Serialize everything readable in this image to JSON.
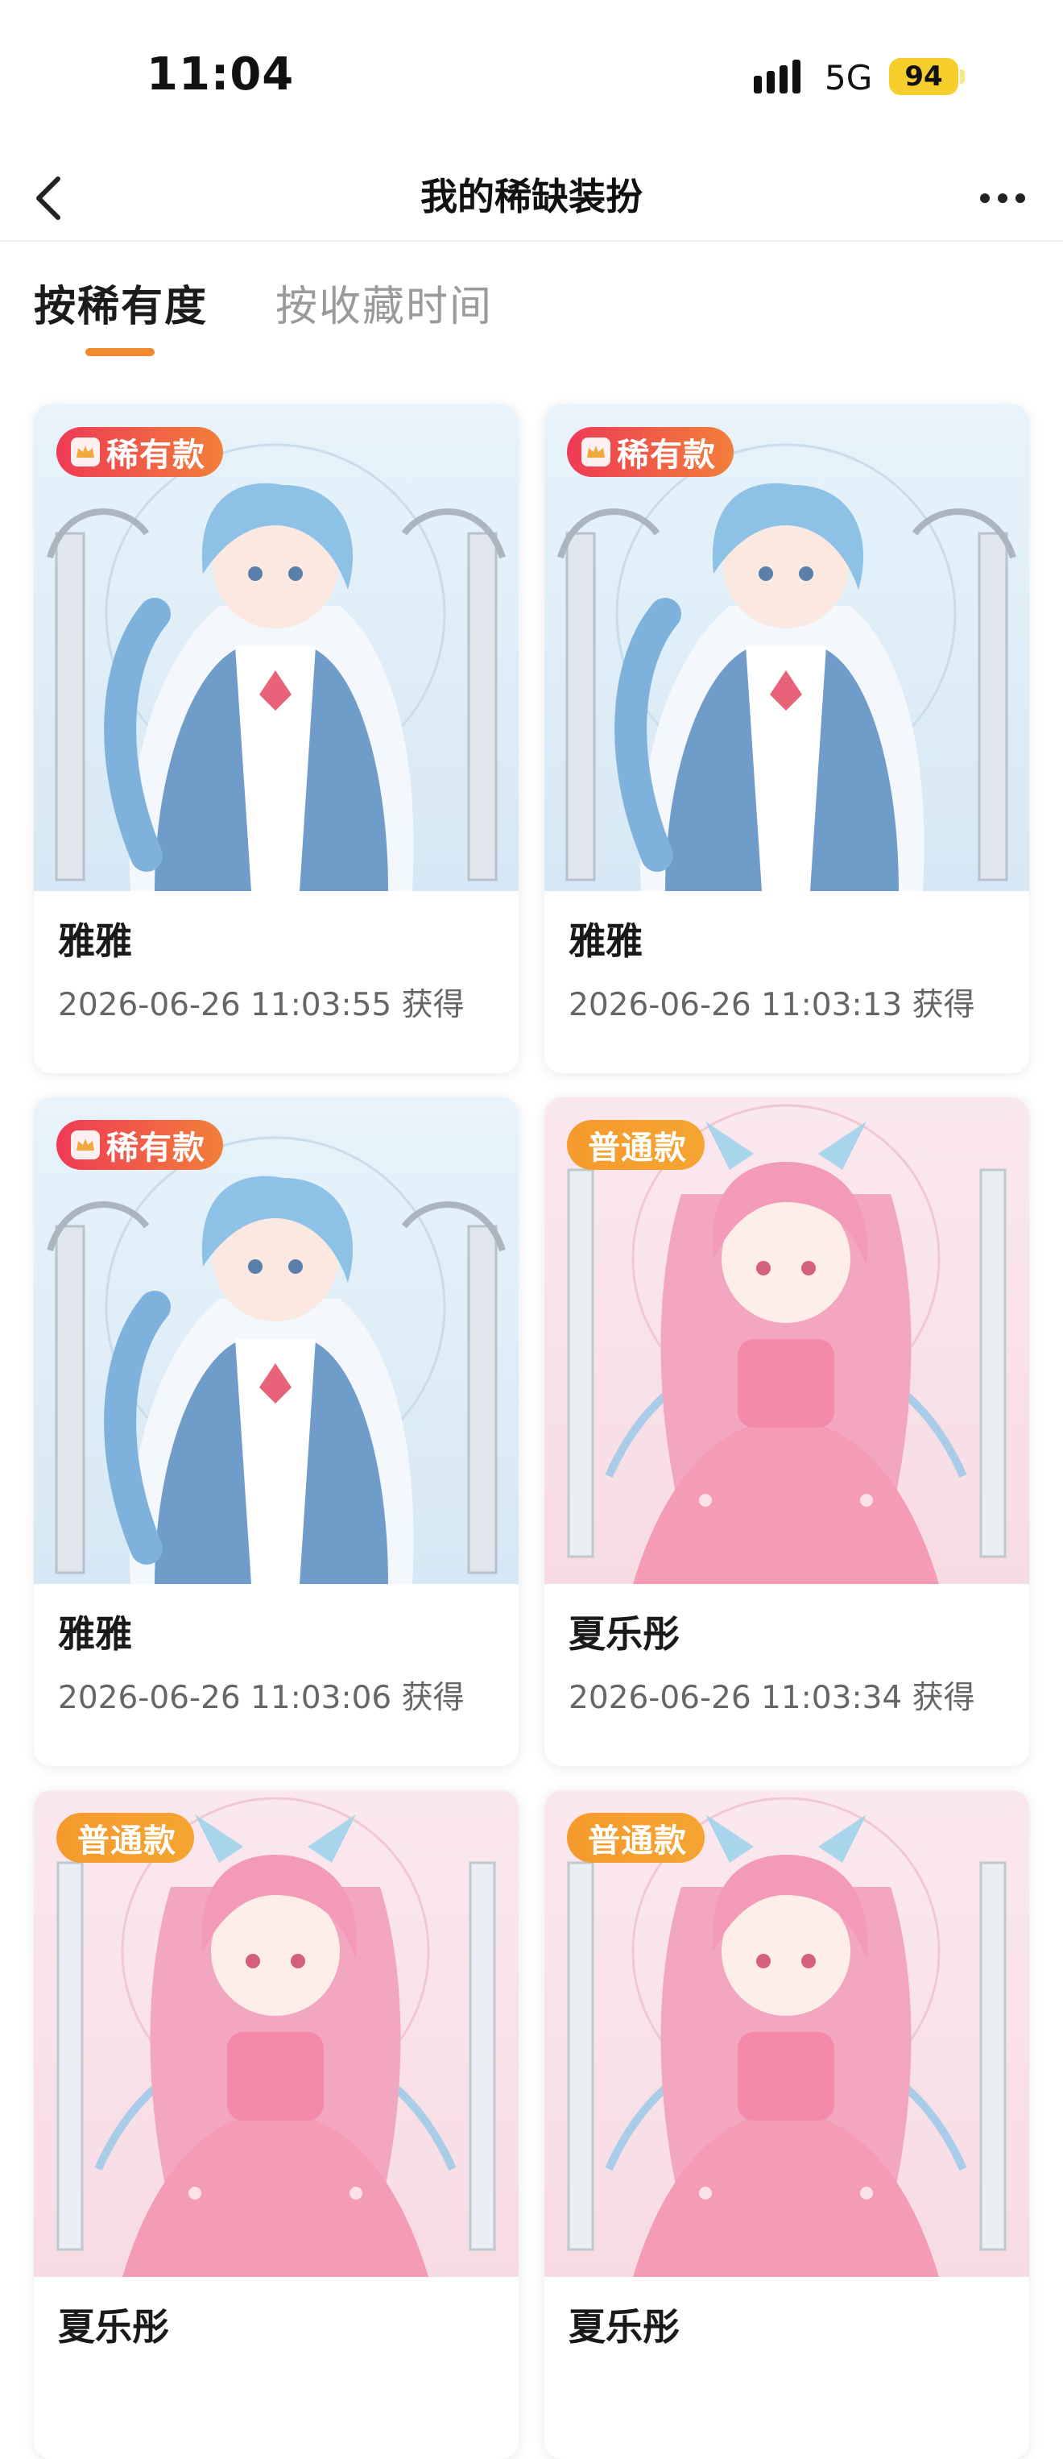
{
  "status_bar": {
    "time": "11:04",
    "network": "5G",
    "battery": "94"
  },
  "nav": {
    "title": "我的稀缺装扮",
    "back_icon": "chevron-left-icon",
    "more_icon": "more-horizontal-icon"
  },
  "tabs": [
    {
      "label": "按稀有度",
      "active": true
    },
    {
      "label": "按收藏时间",
      "active": false
    }
  ],
  "colors": {
    "accent": "#f08a2c",
    "rare_badge": "#ef3a55",
    "normal_badge": "#f59a2e",
    "battery": "#f6cf2c"
  },
  "cards": [
    {
      "badge": "稀有款",
      "rarity": "rare",
      "name": "雅雅",
      "time": "2026-06-26 11:03:55 获得",
      "art": "blue"
    },
    {
      "badge": "稀有款",
      "rarity": "rare",
      "name": "雅雅",
      "time": "2026-06-26 11:03:13 获得",
      "art": "blue"
    },
    {
      "badge": "稀有款",
      "rarity": "rare",
      "name": "雅雅",
      "time": "2026-06-26 11:03:06 获得",
      "art": "blue"
    },
    {
      "badge": "普通款",
      "rarity": "normal",
      "name": "夏乐彤",
      "time": "2026-06-26 11:03:34 获得",
      "art": "pink"
    },
    {
      "badge": "普通款",
      "rarity": "normal",
      "name": "夏乐彤",
      "time": "",
      "art": "pink"
    },
    {
      "badge": "普通款",
      "rarity": "normal",
      "name": "夏乐彤",
      "time": "",
      "art": "pink"
    }
  ]
}
